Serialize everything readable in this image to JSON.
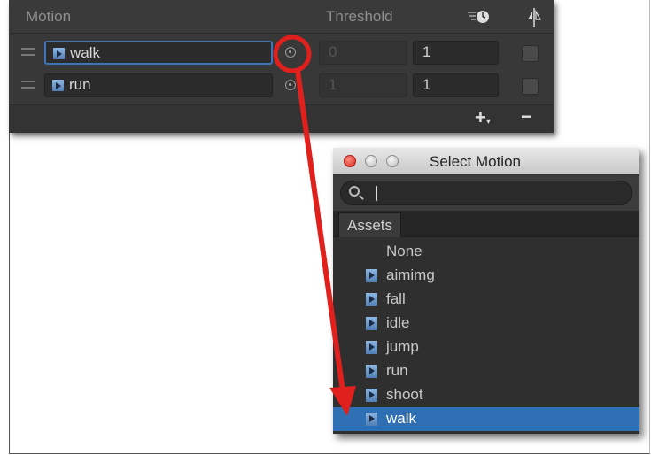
{
  "motion_list": {
    "header": {
      "motion_label": "Motion",
      "threshold_label": "Threshold",
      "speed_icon": "speed-clock-icon",
      "mirror_icon": "mirror-icon"
    },
    "rows": [
      {
        "clip": "walk",
        "threshold": "0",
        "speed": "1",
        "selected": true
      },
      {
        "clip": "run",
        "threshold": "1",
        "speed": "1",
        "selected": false
      }
    ],
    "footer": {
      "add_label": "+",
      "add_sub": "▾",
      "remove_label": "−"
    }
  },
  "select_motion_window": {
    "title": "Select Motion",
    "search": {
      "value": "",
      "placeholder": ""
    },
    "tab_label": "Assets",
    "items": [
      {
        "label": "None",
        "icon": false,
        "selected": false
      },
      {
        "label": "aimimg",
        "icon": true,
        "selected": false
      },
      {
        "label": "fall",
        "icon": true,
        "selected": false
      },
      {
        "label": "idle",
        "icon": true,
        "selected": false
      },
      {
        "label": "jump",
        "icon": true,
        "selected": false
      },
      {
        "label": "run",
        "icon": true,
        "selected": false
      },
      {
        "label": "shoot",
        "icon": true,
        "selected": false
      },
      {
        "label": "walk",
        "icon": true,
        "selected": true
      }
    ]
  },
  "annotation": {
    "color": "#e0201c"
  },
  "colors": {
    "panel_bg": "#383838",
    "selection": "#2f6fb3",
    "accent_blue": "#3c76b8"
  }
}
